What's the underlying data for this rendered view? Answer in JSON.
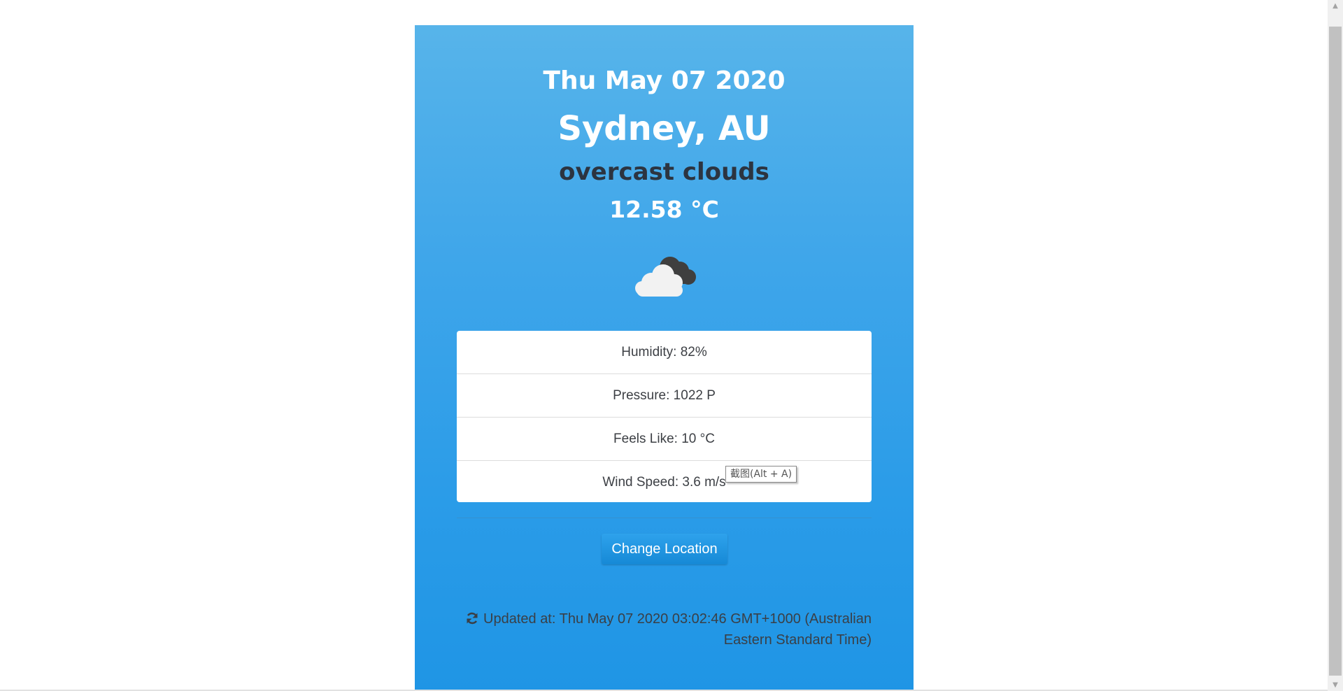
{
  "weather": {
    "date": "Thu May 07 2020",
    "location": "Sydney, AU",
    "description": "overcast clouds",
    "temperature": "12.58 °C",
    "icon": "overcast-clouds-icon"
  },
  "details": [
    {
      "label": "Humidity: 82%"
    },
    {
      "label": "Pressure: 1022 P"
    },
    {
      "label": "Feels Like: 10 °C"
    },
    {
      "label": "Wind Speed: 3.6 m/s"
    }
  ],
  "actions": {
    "change_location_label": "Change Location"
  },
  "footer": {
    "updated_text": "Updated at: Thu May 07 2020 03:02:46 GMT+1000 (Australian Eastern Standard Time)",
    "icon": "refresh-icon"
  },
  "tooltip": {
    "text": "截图(Alt + A)"
  },
  "colors": {
    "card_top": "#57b4ea",
    "card_bottom": "#1f95e5",
    "button": "#1c92df",
    "description_text": "#2c3440"
  }
}
